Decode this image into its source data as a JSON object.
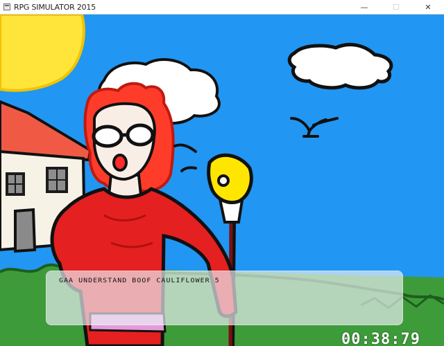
{
  "window": {
    "title": "RPG SIMULATOR 2015",
    "controls": {
      "minimize": "—",
      "maximize": "☐",
      "close": "✕"
    }
  },
  "scene": {
    "sky_color": "#2196f3",
    "sun_color": "#ffe43a",
    "grass_color": "#3e9b3a",
    "house_roof_color": "#f05a45",
    "dress_color": "#e52020",
    "hair_color": "#ff3b2a",
    "sash_color": "#e39ad8",
    "wand_orb_color": "#ffe600"
  },
  "dialog": {
    "text": "GAA UNDERSTAND BOOF CAULIFLOWER 5"
  },
  "hud": {
    "timer": "00:38:79"
  }
}
